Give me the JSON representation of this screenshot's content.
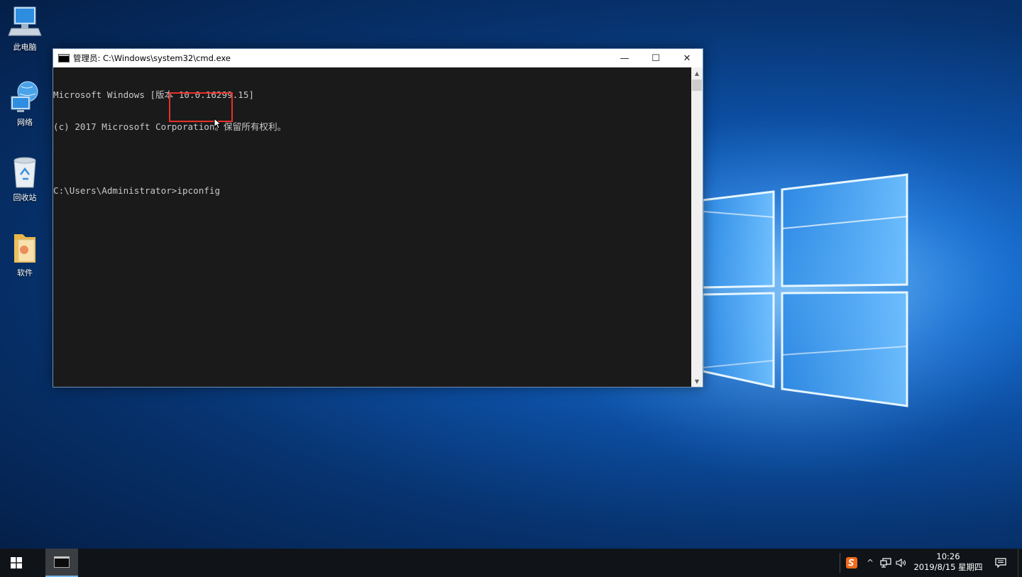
{
  "desktop": {
    "icons": [
      {
        "label": "此电脑",
        "icon": "computer-icon"
      },
      {
        "label": "网络",
        "icon": "network-globe-icon"
      },
      {
        "label": "回收站",
        "icon": "recycle-bin-icon"
      },
      {
        "label": "软件",
        "icon": "folder-icon"
      }
    ]
  },
  "cmd_window": {
    "title": "管理员: C:\\Windows\\system32\\cmd.exe",
    "minimize_glyph": "—",
    "maximize_glyph": "☐",
    "close_glyph": "✕",
    "lines": [
      "Microsoft Windows [版本 10.0.16299.15]",
      "(c) 2017 Microsoft Corporation。保留所有权利。",
      "",
      "C:\\Users\\Administrator>ipconfig"
    ]
  },
  "taskbar": {
    "clock_time": "10:26",
    "clock_date": "2019/8/15 星期四",
    "tray_chevron": "^"
  },
  "colors": {
    "accent": "#76b9ed",
    "highlight_box": "#e8302a",
    "terminal_bg": "#1a1a1a",
    "terminal_text": "#c8c8c8"
  }
}
